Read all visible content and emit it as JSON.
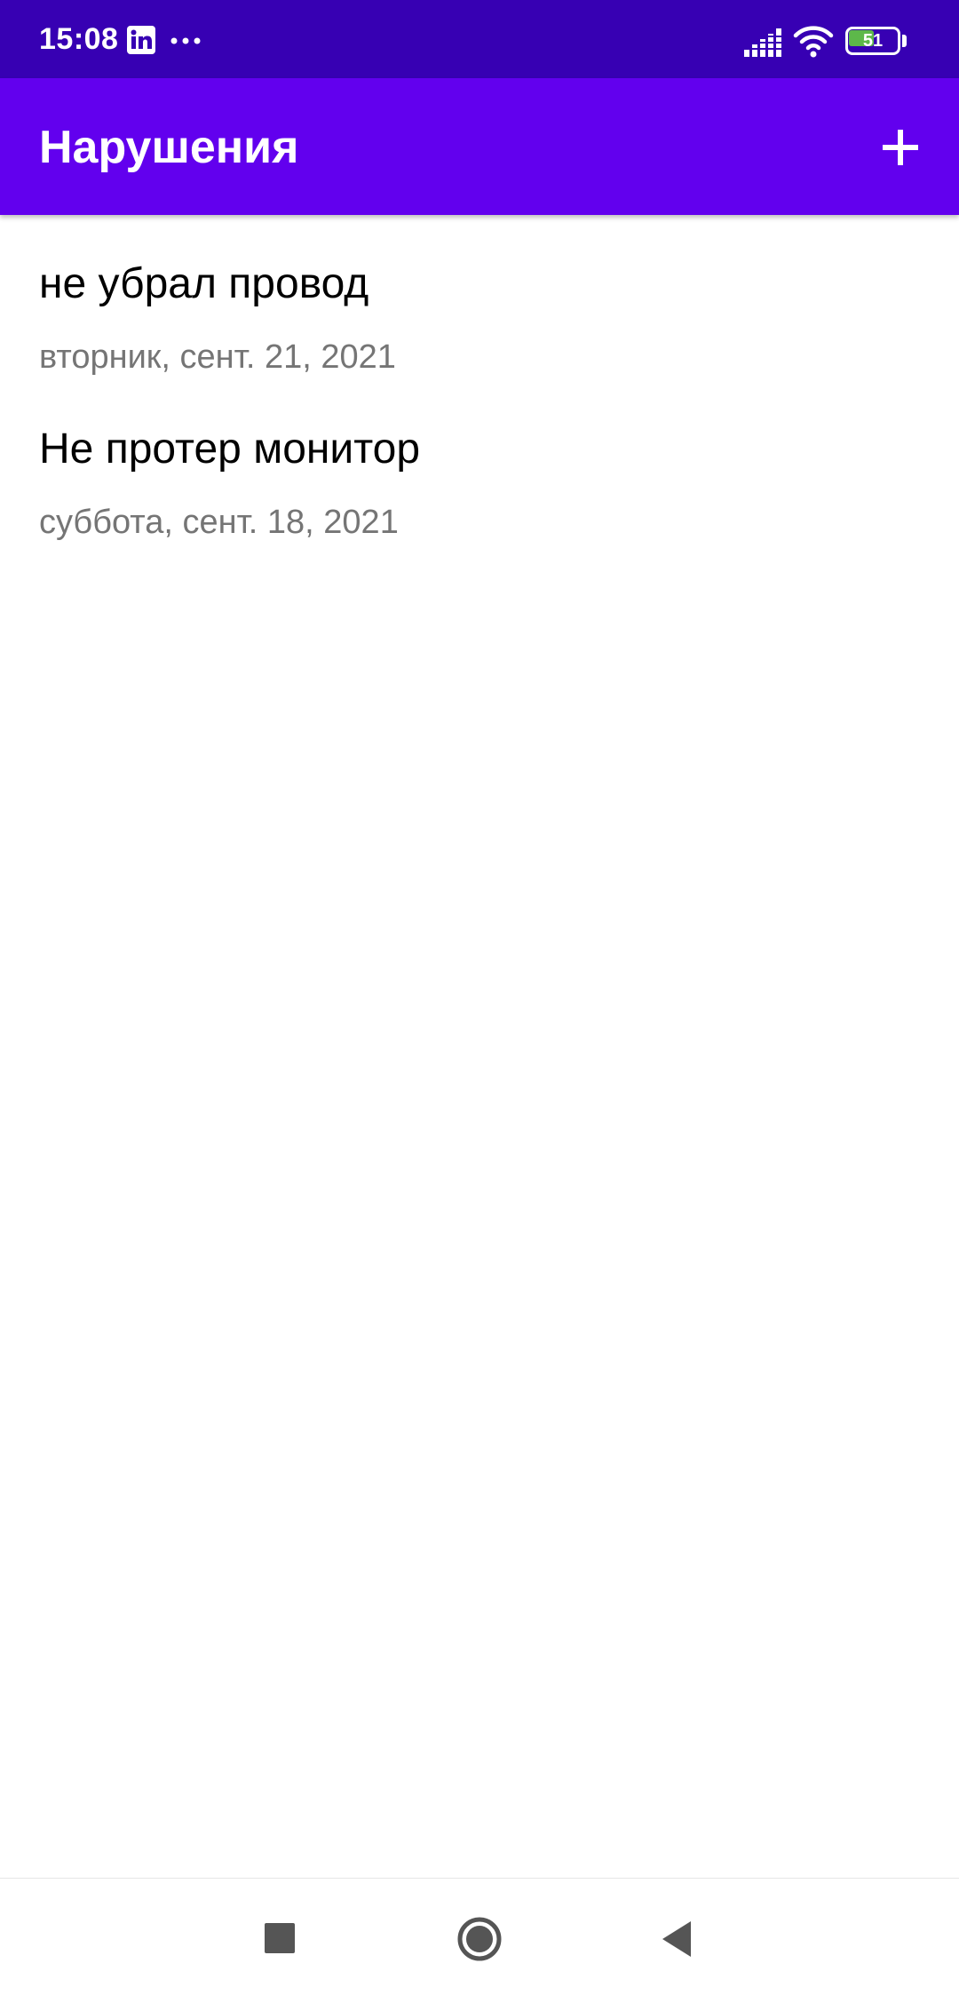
{
  "status_bar": {
    "time": "15:08",
    "battery_level": "51",
    "battery_fraction": 0.51,
    "icons": [
      "linkedin-icon",
      "more-dots-icon",
      "signal-icon",
      "wifi-icon",
      "battery-icon"
    ]
  },
  "app_bar": {
    "title": "Нарушения",
    "add_icon": "plus-icon"
  },
  "violations": [
    {
      "title": "не убрал провод",
      "date": "вторник, сент. 21, 2021"
    },
    {
      "title": "Не протер монитор",
      "date": "суббота, сент. 18, 2021"
    }
  ],
  "nav_bar": {
    "icons": [
      "recents-square-icon",
      "home-circle-icon",
      "back-triangle-icon"
    ]
  },
  "colors": {
    "status_bar": "#3700B3",
    "app_bar": "#6200EE",
    "battery_fill": "#5db84a",
    "secondary_text": "#757575"
  }
}
